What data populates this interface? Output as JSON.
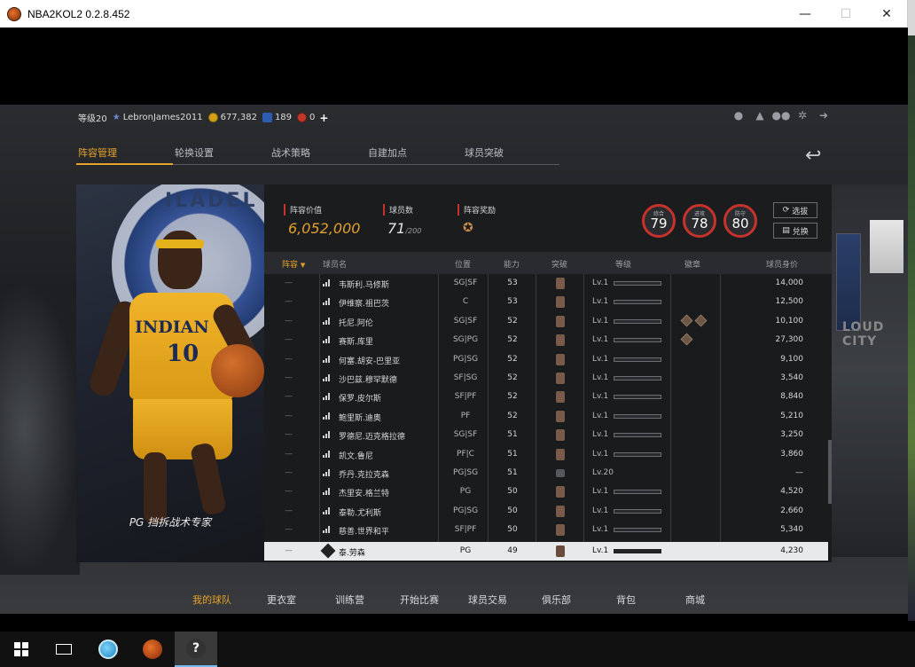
{
  "window": {
    "title": "NBA2KOL2 0.2.8.452",
    "minimize": "—",
    "maximize": "☐",
    "close": "✕"
  },
  "topinfo": {
    "level": "等级20",
    "username": "LebronJames2011",
    "gold": "677,382",
    "stars": "189",
    "tickets": "0",
    "add": "+"
  },
  "topicons": [
    "person-icon",
    "bell-icon",
    "friends-icon",
    "gear-icon",
    "exit-icon"
  ],
  "tabs": [
    "阵容管理",
    "轮换设置",
    "战术策略",
    "自建加点",
    "球员突破"
  ],
  "portrait": {
    "team_text": "ILADEL",
    "jersey_text": "INDIAN",
    "jersey_number": "10",
    "caption": "PG 挡拆战术专家"
  },
  "background": {
    "city_text": "LOUD CITY"
  },
  "stats": {
    "value_label": "阵容价值",
    "value": "6,052,000",
    "count_label": "球员数",
    "count": "71",
    "count_max": "/200",
    "reward_label": "阵容奖励"
  },
  "rings": [
    {
      "label": "综合",
      "value": "79"
    },
    {
      "label": "进攻",
      "value": "78"
    },
    {
      "label": "防守",
      "value": "80"
    }
  ],
  "buttons": {
    "select": "选拔",
    "exchange": "兑换"
  },
  "table": {
    "headers": {
      "lineup": "阵容",
      "lineup_arrow": "▼",
      "name": "球员名",
      "position": "位置",
      "ability": "能力",
      "breakthrough": "突破",
      "grade": "等级",
      "badge": "徽章",
      "price": "球员身价"
    },
    "rows": [
      {
        "lineup": "—",
        "name": "韦斯利.马修斯",
        "pos": "SG|SF",
        "ovr": "53",
        "lv": "Lv.1",
        "badges": 0,
        "price": "14,000"
      },
      {
        "lineup": "—",
        "name": "伊维察.祖巴茨",
        "pos": "C",
        "ovr": "53",
        "lv": "Lv.1",
        "badges": 0,
        "price": "12,500"
      },
      {
        "lineup": "—",
        "name": "托尼.阿伦",
        "pos": "SG|SF",
        "ovr": "52",
        "lv": "Lv.1",
        "badges": 2,
        "price": "10,100"
      },
      {
        "lineup": "—",
        "name": "赛斯.库里",
        "pos": "SG|PG",
        "ovr": "52",
        "lv": "Lv.1",
        "badges": 1,
        "price": "27,300"
      },
      {
        "lineup": "—",
        "name": "何塞.胡安-巴里亚",
        "pos": "PG|SG",
        "ovr": "52",
        "lv": "Lv.1",
        "badges": 0,
        "price": "9,100"
      },
      {
        "lineup": "—",
        "name": "沙巴兹.穆罕默德",
        "pos": "SF|SG",
        "ovr": "52",
        "lv": "Lv.1",
        "badges": 0,
        "price": "3,540"
      },
      {
        "lineup": "—",
        "name": "保罗.皮尔斯",
        "pos": "SF|PF",
        "ovr": "52",
        "lv": "Lv.1",
        "badges": 0,
        "price": "8,840"
      },
      {
        "lineup": "—",
        "name": "鲍里斯.迪奥",
        "pos": "PF",
        "ovr": "52",
        "lv": "Lv.1",
        "badges": 0,
        "price": "5,210"
      },
      {
        "lineup": "—",
        "name": "罗德尼.迈克格拉德",
        "pos": "SG|SF",
        "ovr": "51",
        "lv": "Lv.1",
        "badges": 0,
        "price": "3,250"
      },
      {
        "lineup": "—",
        "name": "凯文.鲁尼",
        "pos": "PF|C",
        "ovr": "51",
        "lv": "Lv.1",
        "badges": 0,
        "price": "3,860"
      },
      {
        "lineup": "—",
        "name": "乔丹.克拉克森",
        "pos": "PG|SG",
        "ovr": "51",
        "lv": "Lv.20",
        "badges": 0,
        "price": "—",
        "grey": true
      },
      {
        "lineup": "—",
        "name": "杰里安.格兰特",
        "pos": "PG",
        "ovr": "50",
        "lv": "Lv.1",
        "badges": 0,
        "price": "4,520"
      },
      {
        "lineup": "—",
        "name": "泰勒.尤利斯",
        "pos": "PG|SG",
        "ovr": "50",
        "lv": "Lv.1",
        "badges": 0,
        "price": "2,660"
      },
      {
        "lineup": "—",
        "name": "慈善.世界和平",
        "pos": "SF|PF",
        "ovr": "50",
        "lv": "Lv.1",
        "badges": 0,
        "price": "5,340"
      }
    ],
    "selected": {
      "lineup": "—",
      "name": "泰.劳森",
      "pos": "PG",
      "ovr": "49",
      "lv": "Lv.1",
      "price": "4,230"
    }
  },
  "bottomnav": [
    "我的球队",
    "更衣室",
    "训练营",
    "开始比赛",
    "球员交易",
    "俱乐部",
    "背包",
    "商城"
  ],
  "taskbar": {
    "help": "?"
  }
}
